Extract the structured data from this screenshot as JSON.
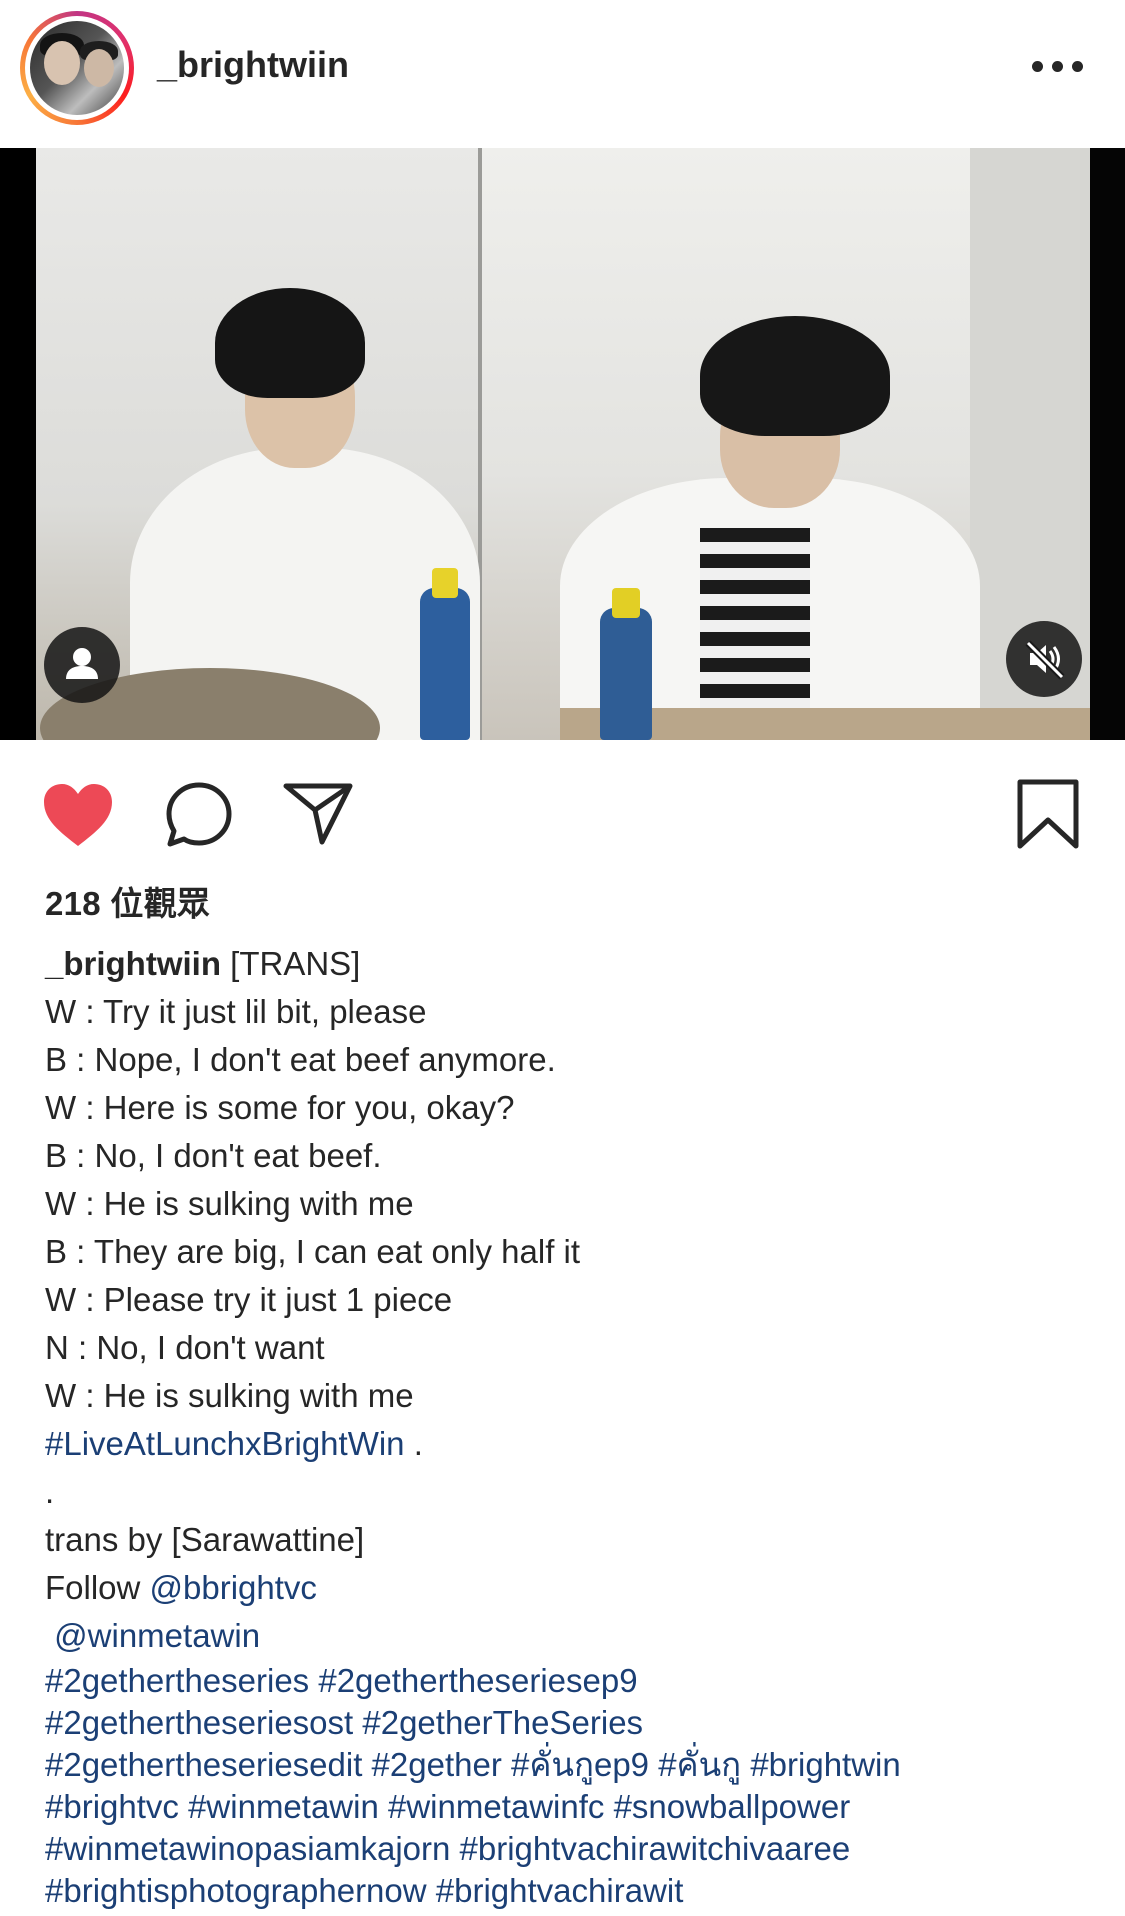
{
  "header": {
    "username": "_brightwiin",
    "more_icon": "more-horizontal-icon"
  },
  "media": {
    "user_tag_icon": "person-icon",
    "mute_icon": "volume-muted-icon"
  },
  "actions": {
    "like_icon": "heart-filled-icon",
    "like_color": "#ed4956",
    "comment_icon": "comment-icon",
    "share_icon": "paper-plane-icon",
    "save_icon": "bookmark-icon"
  },
  "views_text": "218 位觀眾",
  "caption": {
    "username": "_brightwiin",
    "first_text": " [TRANS]",
    "lines": [
      "W : Try it just lil bit, please",
      "B : Nope, I don't eat beef anymore.",
      "W : Here is some for you, okay?",
      "B : No, I don't eat beef.",
      "W : He is sulking with me",
      "B : They are big, I can eat only half it",
      "W : Please try it just 1 piece",
      "N : No, I don't want",
      "W : He is sulking with me"
    ],
    "hashtag_live": "#LiveAtLunchxBrightWin",
    "after_live": " .",
    "dot_line": ".",
    "trans_line": "trans by [Sarawattine]",
    "follow_prefix": "Follow ",
    "mention1": "@bbrightvc",
    "mention2": " @winmetawin",
    "hashtag_lines": [
      "#2gethertheseries #2gethertheseriesep9",
      "#2gethertheseriesost #2getherTheSeries",
      "#2gethertheseriesedit #2gether #คั่นกูep9 #คั่นกู #brightwin",
      "#brightvc #winmetawin #winmetawinfc #snowballpower",
      "#winmetawinopasiamkajorn #brightvachirawitchivaaree",
      "#brightisphotographernow #brightvachirawit"
    ]
  },
  "colors": {
    "link": "#1b3f75",
    "text": "#262626"
  }
}
